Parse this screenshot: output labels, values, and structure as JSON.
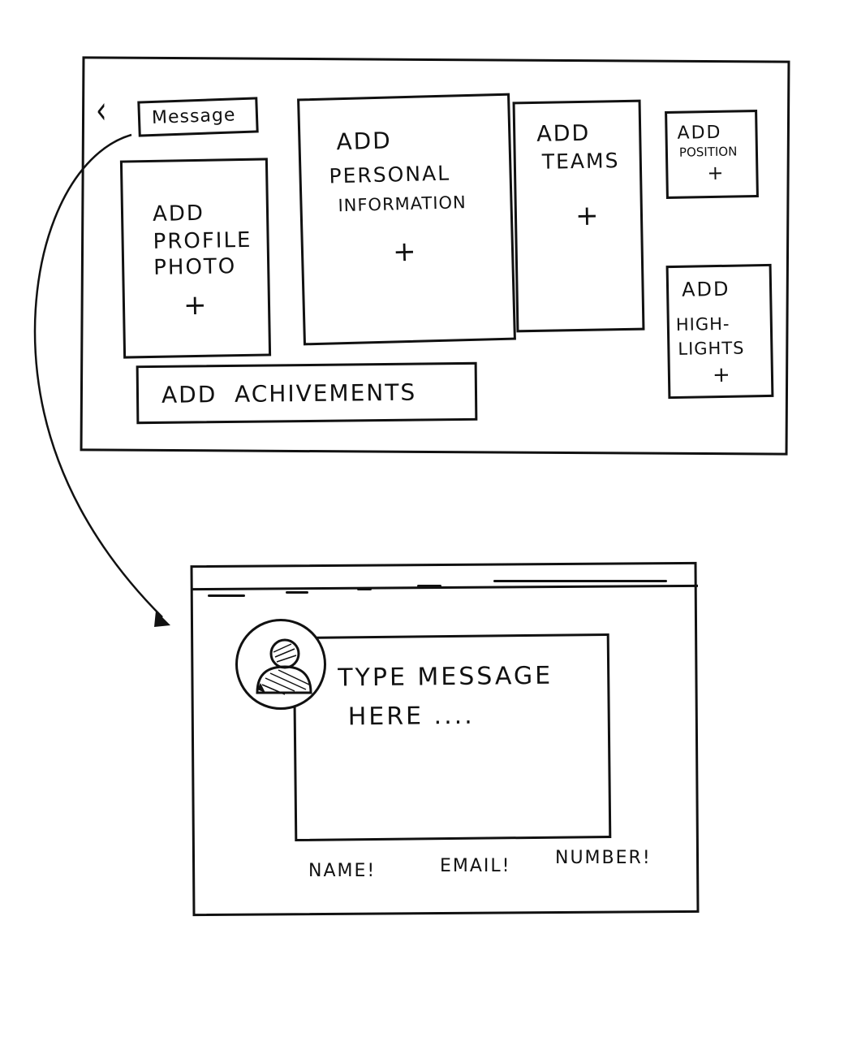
{
  "profile_editor": {
    "message_button": "Message",
    "cards": {
      "profile_photo": {
        "lines": [
          "ADD",
          "PROFILE",
          "PHOTO"
        ],
        "plus": "+"
      },
      "personal_info": {
        "lines": [
          "ADD",
          "PERSONAL",
          "INFORMATION"
        ],
        "plus": "+"
      },
      "teams": {
        "lines": [
          "ADD",
          "TEAMS"
        ],
        "plus": "+"
      },
      "position": {
        "lines": [
          "ADD",
          "POSITION"
        ],
        "plus": "+"
      },
      "highlights": {
        "lines": [
          "ADD",
          "HIGH-",
          "LIGHTS"
        ],
        "plus": "+"
      },
      "achievements": {
        "label": "ADD  ACHIVEMENTS"
      }
    }
  },
  "message_window": {
    "placeholder_lines": [
      "TYPE MESSAGE",
      "HERE ...."
    ],
    "fields": {
      "name": "NAME!",
      "email": "EMAIL!",
      "number": "NUMBER!"
    }
  }
}
